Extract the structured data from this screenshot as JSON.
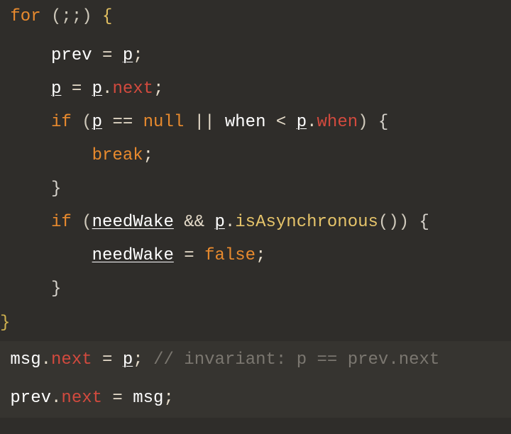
{
  "code": {
    "l1": {
      "for": "for",
      "args": "(;;)",
      "brace": "{"
    },
    "l2": {
      "prev": "prev",
      "eq": " = ",
      "p": "p",
      "semi": ";"
    },
    "l3": {
      "p1": "p",
      "eq": " = ",
      "p2": "p",
      "dot": ".",
      "next": "next",
      "semi": ";"
    },
    "l4": {
      "if": "if",
      "open": " (",
      "p1": "p",
      "eqeq": " == ",
      "null": "null",
      "or": " || ",
      "when1": "when",
      "lt": " < ",
      "p2": "p",
      "dot": ".",
      "when2": "when",
      "close": ")",
      "brace": " {"
    },
    "l5": {
      "break": "break",
      "semi": ";"
    },
    "l6": {
      "close": "}"
    },
    "l7": {
      "if": "if",
      "open": " (",
      "nw": "needWake",
      "and": " && ",
      "p": "p",
      "dot": ".",
      "method": "isAsynchronous",
      "call": "()",
      "close": ")",
      "brace": " {"
    },
    "l8": {
      "nw": "needWake",
      "eq": " = ",
      "false": "false",
      "semi": ";"
    },
    "l9": {
      "close": "}"
    },
    "l10": {
      "close": "}"
    },
    "l11": {
      "msg": "msg",
      "dot": ".",
      "next": "next",
      "eq": " = ",
      "p": "p",
      "semi": "; ",
      "cmt": "// invariant: p == prev.next"
    },
    "l12": {
      "prev": "prev",
      "dot": ".",
      "next": "next",
      "eq": " = ",
      "msg": "msg",
      "semi": ";"
    }
  }
}
